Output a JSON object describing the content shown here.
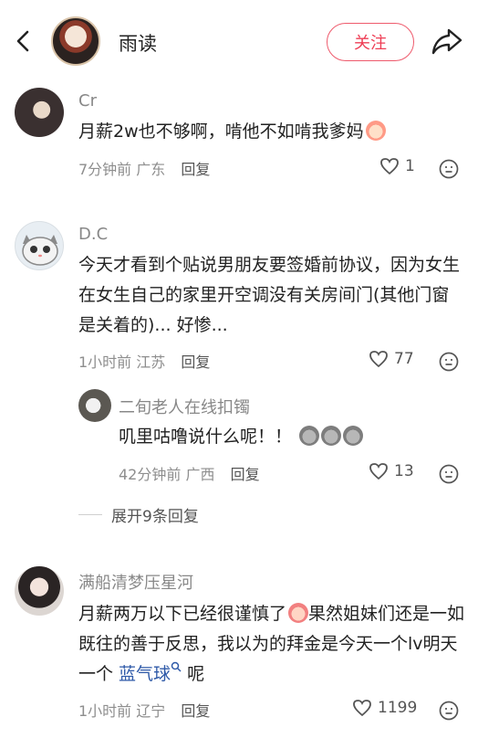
{
  "header": {
    "name": "雨读",
    "follow_label": "关注"
  },
  "comments": [
    {
      "name": "Cr",
      "text": "月薪2w也不够啊，啃他不如啃我爹妈",
      "time": "7分钟前",
      "location": "广东",
      "reply": "回复",
      "likes": "1"
    },
    {
      "name": "D.C",
      "text": "今天才看到个贴说男朋友要签婚前协议，因为女生在女生自己的家里开空调没有关房间门(其他门窗是关着的)... 好惨...",
      "time": "1小时前",
      "location": "江苏",
      "reply": "回复",
      "likes": "77",
      "subreply": {
        "name": "二旬老人在线扣镯",
        "text": "叽里咕噜说什么呢！！",
        "time": "42分钟前",
        "location": "广西",
        "reply": "回复",
        "likes": "13"
      },
      "expand_label": "展开9条回复"
    },
    {
      "name": "满船清梦压星河",
      "text_a": "月薪两万以下已经很谨慎了",
      "text_b": "果然姐妹们还是一如既往的善于反思，我以为的拜金是今天一个lv明天一个 ",
      "link": "蓝气球",
      "text_c": " 呢",
      "time": "1小时前",
      "location": "辽宁",
      "reply": "回复",
      "likes": "1199"
    }
  ],
  "icons": [
    "back-arrow-icon",
    "share-icon",
    "heart-icon",
    "more-emoji-icon",
    "search-icon"
  ],
  "colors": {
    "accent": "#ee3e55",
    "link": "#2f5aa8",
    "muted": "#8e8e8e"
  }
}
